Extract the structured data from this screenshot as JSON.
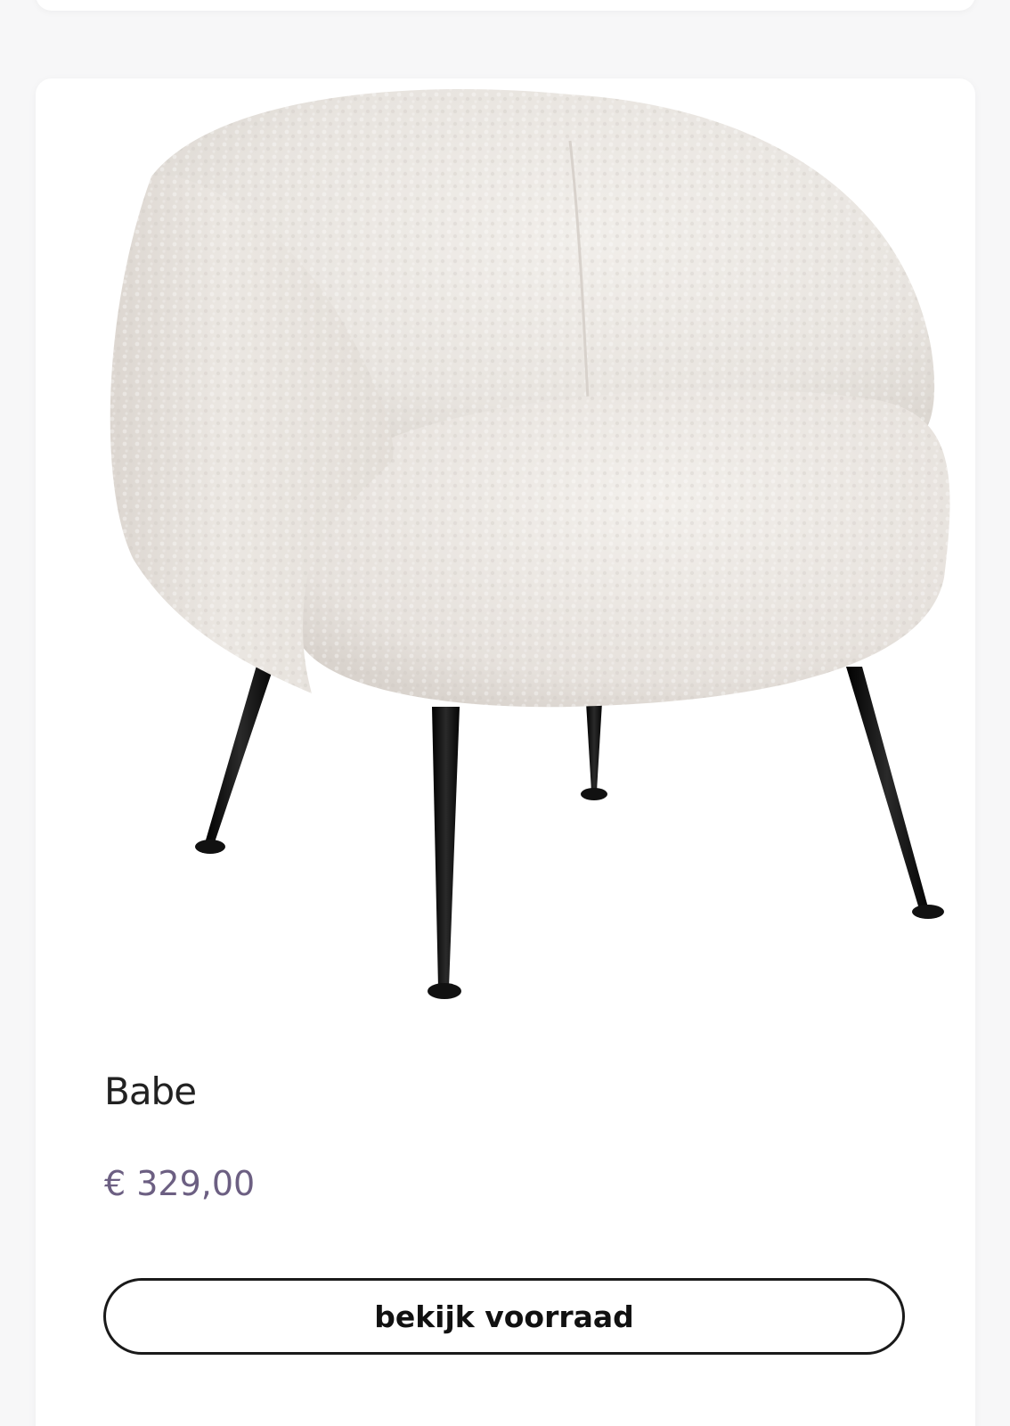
{
  "product": {
    "name": "Babe",
    "price": "€ 329,00",
    "cta_label": "bekijk voorraad"
  },
  "colors": {
    "page_background": "#f7f7f8",
    "card_background": "#ffffff",
    "price_text": "#6c5f82",
    "button_border": "#1a1a1a",
    "upholstery": "#eeeae6",
    "legs": "#141414"
  }
}
